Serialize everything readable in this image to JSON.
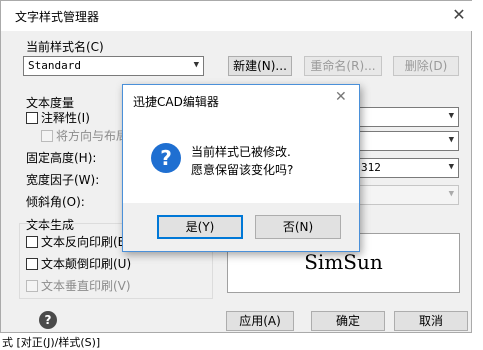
{
  "window": {
    "title": "文字样式管理器",
    "close_glyph": "✕"
  },
  "current_style": {
    "label": "当前样式名(C)",
    "value": "Standard",
    "new_button": "新建(N)...",
    "rename_button": "重命名(R)...",
    "delete_button": "删除(D)"
  },
  "text_measure": {
    "label": "文本度量",
    "annotative_label": "注释性(I)",
    "orient_label": "将方向与布局",
    "fixed_height_label": "固定高度(H):",
    "width_factor_label": "宽度因子(W):",
    "oblique_label": "倾斜角(O):",
    "partial_combo_text": "312"
  },
  "text_generation": {
    "label": "文本生成",
    "reverse_label": "文本反向印刷(B)",
    "upside_down_label": "文本颠倒印刷(U)",
    "vertical_label": "文本垂直印刷(V)"
  },
  "preview": {
    "text": "SimSun"
  },
  "footer": {
    "help_glyph": "?",
    "apply_button": "应用(A)",
    "ok_button": "确定",
    "cancel_button": "取消"
  },
  "dialog": {
    "title": "迅捷CAD编辑器",
    "close_glyph": "✕",
    "icon_glyph": "?",
    "message_line1": "当前样式已被修改.",
    "message_line2": "愿意保留该变化吗?",
    "yes_button": "是(Y)",
    "no_button": "否(N)"
  },
  "statusbar": {
    "text": "式 [对正(J)/样式(S)]"
  }
}
